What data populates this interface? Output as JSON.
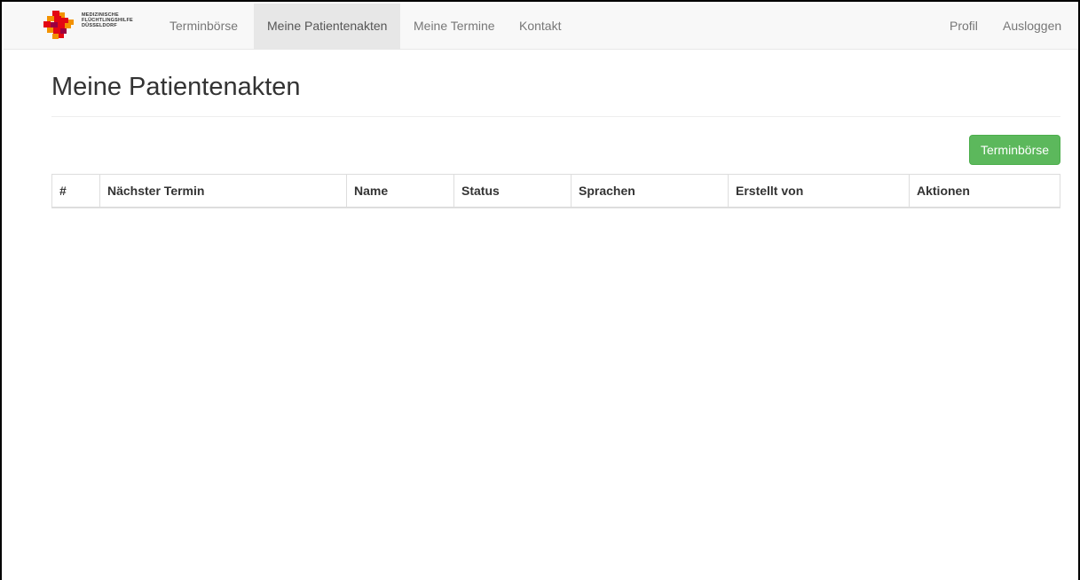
{
  "brand": {
    "line1": "MEDIZINISCHE",
    "line2": "FLÜCHTLINGSHILFE",
    "line3": "DÜSSELDORF",
    "logo_icon": "cross-pixel-logo-icon",
    "logo_colors": [
      "#e30613",
      "#f39200",
      "#9b0040"
    ]
  },
  "nav": {
    "items": [
      {
        "label": "Terminbörse"
      },
      {
        "label": "Meine Patientenakten",
        "active": true
      },
      {
        "label": "Meine Termine"
      },
      {
        "label": "Kontakt"
      }
    ],
    "right": [
      {
        "label": "Profil"
      },
      {
        "label": "Ausloggen"
      }
    ]
  },
  "main": {
    "title": "Meine Patientenakten",
    "button_label": "Terminbörse",
    "button_color": "#5cb85c",
    "table": {
      "headers": [
        "#",
        "Nächster Termin",
        "Name",
        "Status",
        "Sprachen",
        "Erstellt von",
        "Aktionen"
      ],
      "rows": []
    }
  }
}
